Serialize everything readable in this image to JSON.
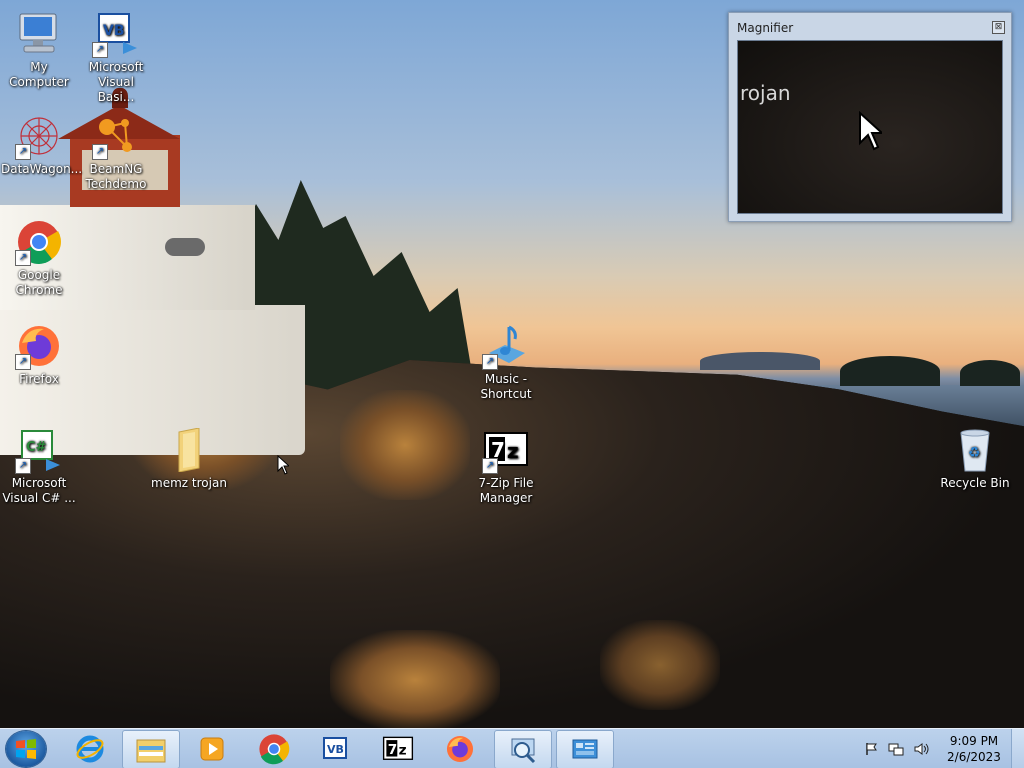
{
  "desktop": {
    "icons": [
      {
        "label": "My Computer"
      },
      {
        "label": "Microsoft Visual Basi..."
      },
      {
        "label": "DataWagon..."
      },
      {
        "label": "BeamNG Techdemo"
      },
      {
        "label": "Google Chrome"
      },
      {
        "label": "Firefox"
      },
      {
        "label": "Music - Shortcut"
      },
      {
        "label": "Microsoft Visual C# ..."
      },
      {
        "label": "memz trojan"
      },
      {
        "label": "7-Zip File Manager"
      },
      {
        "label": "Recycle Bin"
      }
    ]
  },
  "magnifier": {
    "title": "Magnifier",
    "close_label": "⊠",
    "zoomed_text": "rojan"
  },
  "taskbar": {
    "pinned": [
      "Internet Explorer",
      "Windows Explorer",
      "Windows Media Player",
      "Google Chrome",
      "Microsoft Visual Basic",
      "7-Zip File Manager",
      "Firefox",
      "Magnifier",
      "Control Panel"
    ],
    "clock": {
      "time": "9:09 PM",
      "date": "2/6/2023"
    }
  },
  "colors": {
    "taskbar": "#a7c1e2",
    "magnifier_frame": "#c9d6e6",
    "icon_text": "#ffffff"
  }
}
